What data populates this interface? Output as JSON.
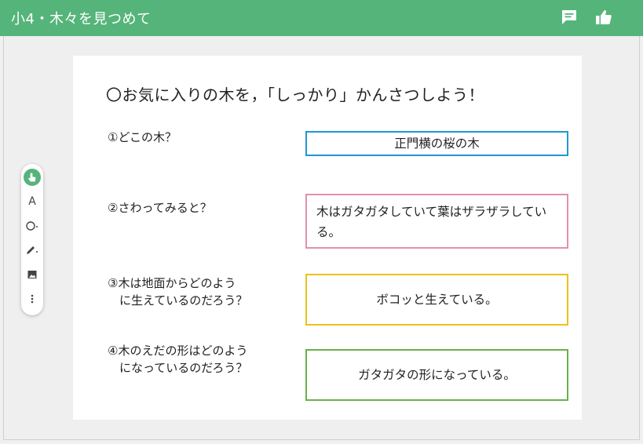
{
  "header": {
    "title": "小4・木々を見つめて",
    "comment_icon": "comment-icon",
    "like_icon": "thumbs-up-icon",
    "color": "#55b47a"
  },
  "slide": {
    "heading": "〇お気に入りの木を，「しっかり」かんさつしよう！",
    "questions": [
      {
        "text": "①どこの木？",
        "answer": "正門横の桜の木",
        "border_color": "#2196d3"
      },
      {
        "text": "②さわってみると？",
        "answer": "木はガタガタしていて葉はザラザラしている。",
        "border_color": "#e28fae"
      },
      {
        "text": "③木は地面からどのよう\n　に生えているのだろう？",
        "answer": "ボコッと生えている。",
        "border_color": "#eac21b"
      },
      {
        "text": "④木のえだの形はどのよう\n　になっているのだろう？",
        "answer": "ガタガタの形になっている。",
        "border_color": "#6ab04c"
      }
    ]
  },
  "toolbar": {
    "tools": [
      {
        "name": "pointer-icon",
        "label": ""
      },
      {
        "name": "text-tool-icon",
        "label": "A"
      },
      {
        "name": "shape-tool-icon",
        "label": ""
      },
      {
        "name": "pen-tool-icon",
        "label": ""
      },
      {
        "name": "image-tool-icon",
        "label": ""
      },
      {
        "name": "more-icon",
        "label": ""
      }
    ]
  }
}
